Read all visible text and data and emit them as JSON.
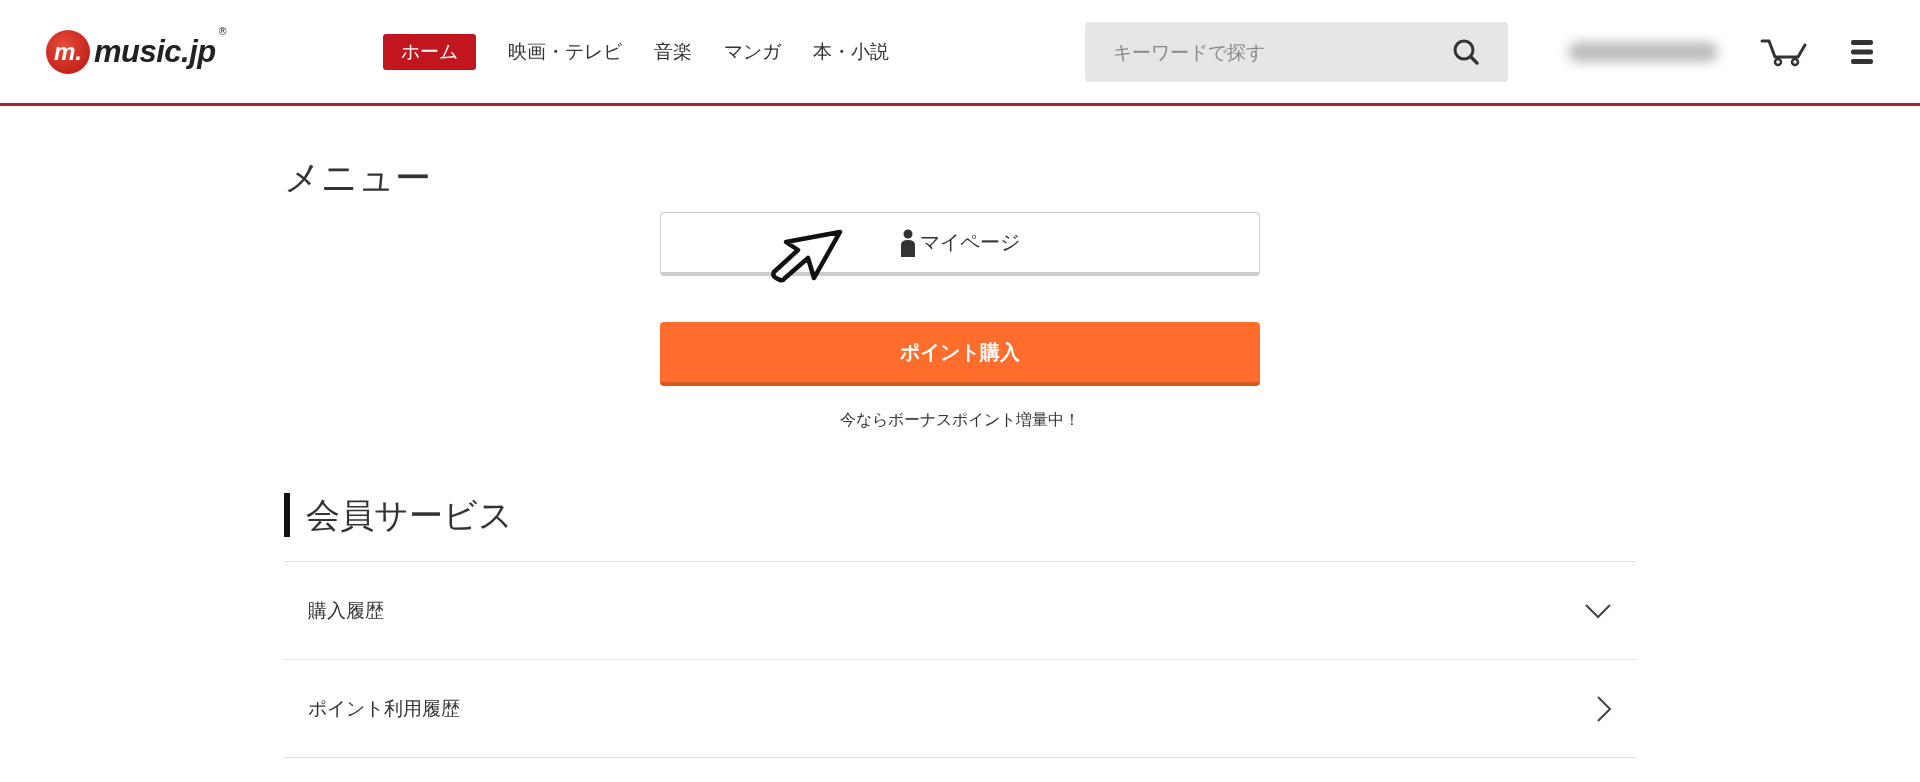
{
  "logo": {
    "badge": "m.",
    "name": "music.jp",
    "registered": "®"
  },
  "nav": [
    {
      "label": "ホーム",
      "selected": true
    },
    {
      "label": "映画・テレビ",
      "selected": false
    },
    {
      "label": "音楽",
      "selected": false
    },
    {
      "label": "マンガ",
      "selected": false
    },
    {
      "label": "本・小説",
      "selected": false
    }
  ],
  "search": {
    "placeholder": "キーワードで探す"
  },
  "page_title": "メニュー",
  "mypage_button": {
    "label": "マイページ"
  },
  "point_button": {
    "label": "ポイント購入"
  },
  "bonus_note": "今ならボーナスポイント増量中！",
  "section": {
    "title": "会員サービス",
    "rows": [
      {
        "label": "購入履歴",
        "kind": "accordion"
      },
      {
        "label": "ポイント利用履歴",
        "kind": "link"
      }
    ]
  }
}
